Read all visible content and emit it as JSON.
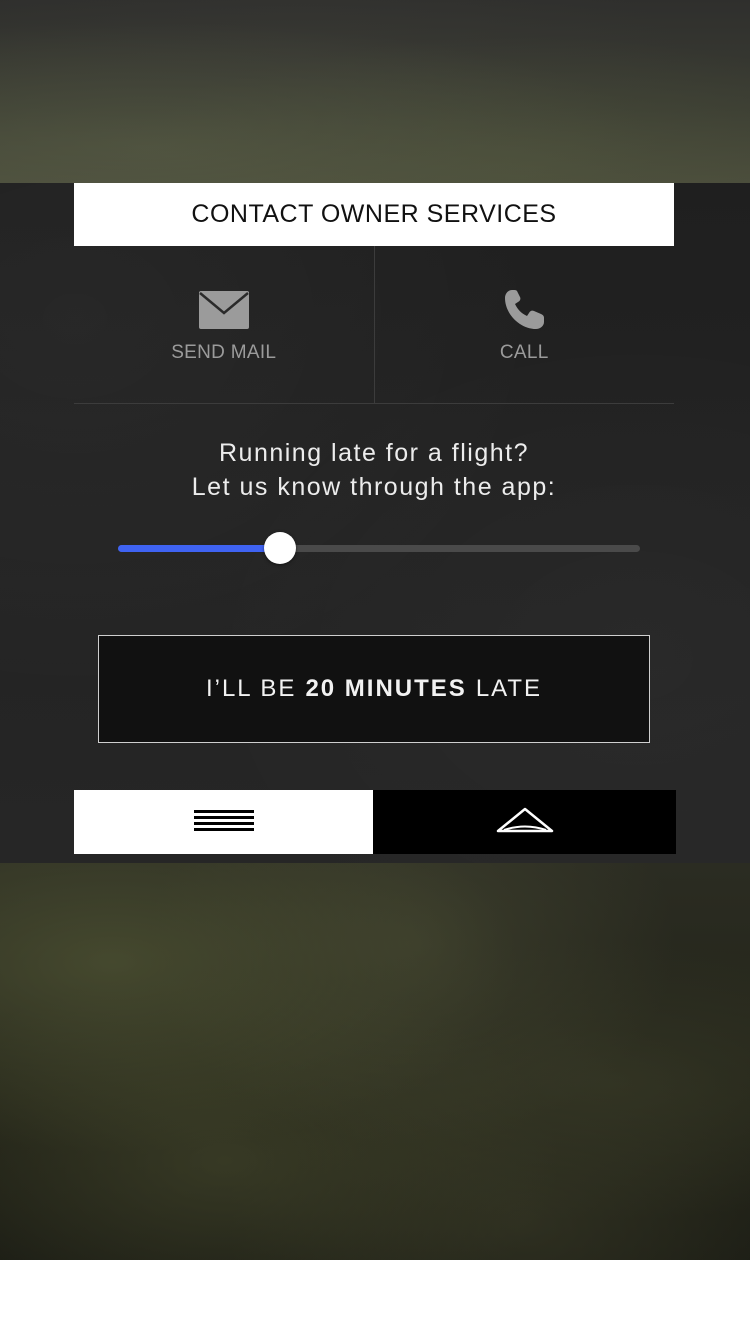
{
  "header": {
    "title": "CONTACT OWNER SERVICES"
  },
  "contact": {
    "mail": {
      "label": "SEND MAIL",
      "icon": "envelope-icon"
    },
    "call": {
      "label": "CALL",
      "icon": "phone-icon"
    }
  },
  "late": {
    "prompt_line1": "Running late for a flight?",
    "prompt_line2": "Let us know through the app:",
    "slider_fraction": 0.31,
    "button_prefix": "I’LL BE",
    "button_value": "20 MINUTES",
    "button_suffix": "LATE"
  },
  "tabs": {
    "menu_icon": "hamburger-menu-icon",
    "home_icon": "wing-logo-icon"
  },
  "colors": {
    "accent": "#3f63f2",
    "panel": "#222222"
  }
}
